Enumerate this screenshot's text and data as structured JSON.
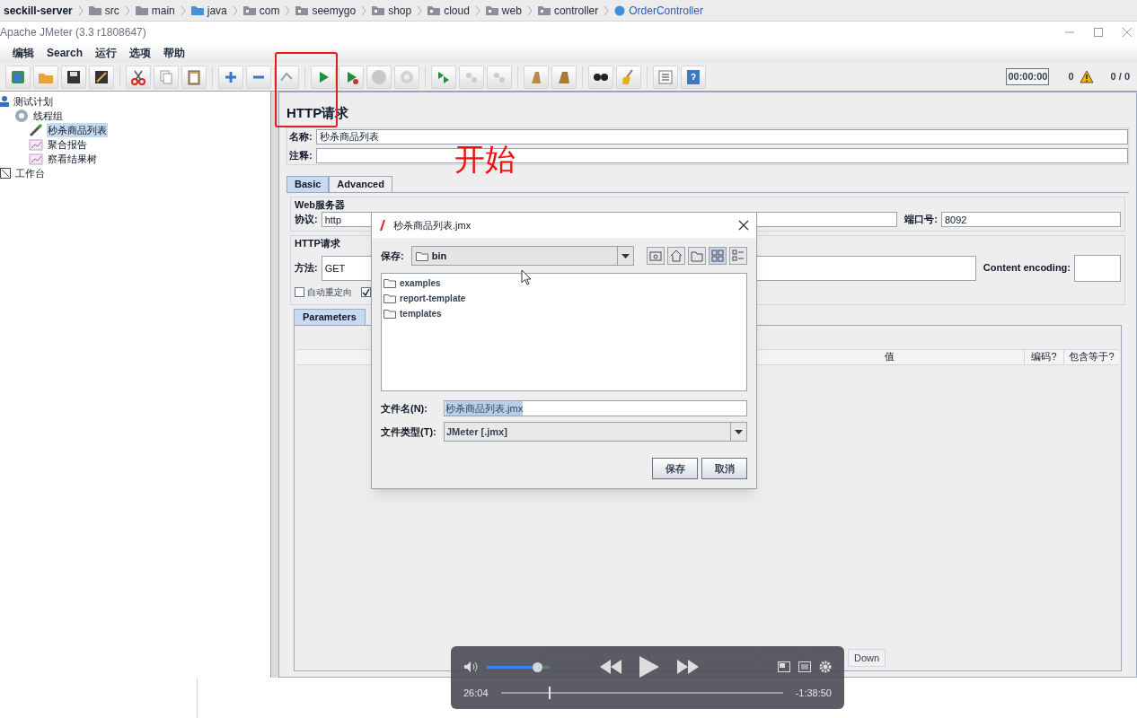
{
  "breadcrumb": [
    {
      "label": "seckill-server",
      "kind": "project"
    },
    {
      "label": "src",
      "kind": "folder"
    },
    {
      "label": "main",
      "kind": "folder"
    },
    {
      "label": "java",
      "kind": "source"
    },
    {
      "label": "com",
      "kind": "package"
    },
    {
      "label": "seemygo",
      "kind": "package"
    },
    {
      "label": "shop",
      "kind": "package"
    },
    {
      "label": "cloud",
      "kind": "package"
    },
    {
      "label": "web",
      "kind": "package"
    },
    {
      "label": "controller",
      "kind": "package"
    },
    {
      "label": "OrderController",
      "kind": "class"
    }
  ],
  "window": {
    "title": "Apache JMeter (3.3 r1808647)"
  },
  "menu": [
    "编辑",
    "Search",
    "运行",
    "选项",
    "帮助"
  ],
  "toolbar_status": {
    "timer": "00:00:00",
    "warnings": "0",
    "threads": "0 / 0"
  },
  "tree": [
    {
      "label": "测试计划",
      "kind": "plan",
      "selected": false,
      "children": [
        {
          "label": "线程组",
          "kind": "group",
          "selected": false,
          "children": [
            {
              "label": "秒杀商品列表",
              "kind": "sampler",
              "selected": true
            },
            {
              "label": "聚合报告",
              "kind": "listener",
              "selected": false
            },
            {
              "label": "察看结果树",
              "kind": "listener",
              "selected": false
            }
          ]
        }
      ]
    },
    {
      "label": "工作台",
      "kind": "workbench",
      "selected": false
    }
  ],
  "panel": {
    "title": "HTTP请求",
    "name_label": "名称:",
    "name_value": "秒杀商品列表",
    "comment_label": "注释:",
    "tabs": [
      {
        "label": "Basic",
        "selected": true
      },
      {
        "label": "Advanced",
        "selected": false
      }
    ],
    "web_server": {
      "legend": "Web服务器",
      "protocol_label": "协议:",
      "protocol_value": "http",
      "port_label": "端口号:",
      "port_value": "8092"
    },
    "http_request": {
      "legend": "HTTP请求",
      "method_label": "方法:",
      "method_value": "GET",
      "encoding_label": "Content encoding:"
    },
    "options": [
      {
        "label": "自动重定向",
        "checked": false
      },
      {
        "checked": true
      }
    ],
    "param_tabs": [
      {
        "label": "Parameters",
        "selected": true
      }
    ],
    "columns": [
      "值",
      "编码?",
      "包含等于?"
    ],
    "buttons": [
      "Down"
    ]
  },
  "annotation": {
    "text": "开始"
  },
  "dialog": {
    "title": "秒杀商品列表.jmx",
    "save_in_label": "保存:",
    "save_in_value": "bin",
    "files": [
      "examples",
      "report-template",
      "templates"
    ],
    "filename_label": "文件名(N):",
    "filename_value": "秒杀商品列表.jmx",
    "filetype_label": "文件类型(T):",
    "filetype_value": "JMeter [.jmx]",
    "buttons": [
      "保存",
      "取消"
    ]
  },
  "player": {
    "volume": {
      "level": 0.8
    },
    "elapsed": "26:04",
    "remaining": "-1:38:50",
    "progress": {
      "level": 0.17
    }
  }
}
